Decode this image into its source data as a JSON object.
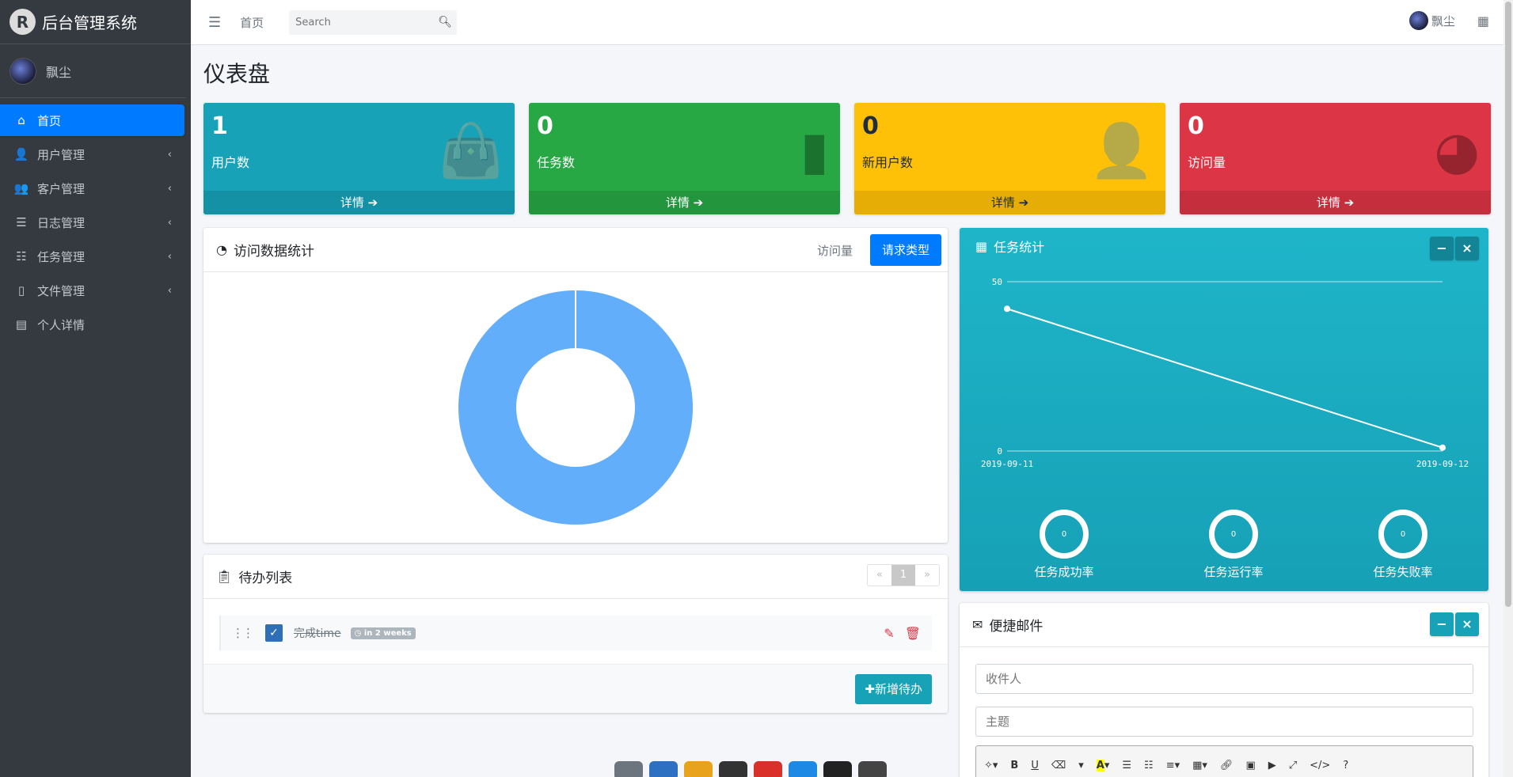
{
  "brand": {
    "title": "后台管理系统",
    "logo_letter": "R"
  },
  "user": {
    "name": "飘尘"
  },
  "sidebar": {
    "items": [
      {
        "label": "首页",
        "icon": "home-icon",
        "glyph": "⌂",
        "active": true,
        "has_caret": false
      },
      {
        "label": "用户管理",
        "icon": "user-icon",
        "glyph": "👤",
        "active": false,
        "has_caret": true
      },
      {
        "label": "客户管理",
        "icon": "users-icon",
        "glyph": "👥",
        "active": false,
        "has_caret": true
      },
      {
        "label": "日志管理",
        "icon": "database-icon",
        "glyph": "☰",
        "active": false,
        "has_caret": true
      },
      {
        "label": "任务管理",
        "icon": "tasks-icon",
        "glyph": "☷",
        "active": false,
        "has_caret": true
      },
      {
        "label": "文件管理",
        "icon": "file-icon",
        "glyph": "▯",
        "active": false,
        "has_caret": true
      },
      {
        "label": "个人详情",
        "icon": "id-card-icon",
        "glyph": "▤",
        "active": false,
        "has_caret": false
      }
    ]
  },
  "topbar": {
    "home": "首页",
    "search_placeholder": "Search",
    "user": "飘尘"
  },
  "page": {
    "title": "仪表盘"
  },
  "stat_boxes": [
    {
      "value": "1",
      "label": "用户数",
      "footer": "详情 ➔",
      "icon": "shopping-bag-icon",
      "glyph": "👜",
      "color": "#17a2b8"
    },
    {
      "value": "0",
      "label": "任务数",
      "footer": "详情 ➔",
      "icon": "bar-chart-icon",
      "glyph": "▮",
      "color": "#28a745"
    },
    {
      "value": "0",
      "label": "新用户数",
      "footer": "详情 ➔",
      "icon": "user-plus-icon",
      "glyph": "👤",
      "color": "#ffc107"
    },
    {
      "value": "0",
      "label": "访问量",
      "footer": "详情 ➔",
      "icon": "pie-chart-icon",
      "glyph": "◕",
      "color": "#dc3545"
    }
  ],
  "visit_card": {
    "title": "访问数据统计",
    "tab_link": "访问量",
    "tab_active": "请求类型"
  },
  "todo_card": {
    "title": "待办列表",
    "pager": [
      "«",
      "1",
      "»"
    ],
    "items": [
      {
        "text": "完成time",
        "badge": "in 2 weeks",
        "done": true
      }
    ],
    "add_button": "✚新增待办"
  },
  "task_card": {
    "title": "任务统计",
    "knobs": [
      {
        "label": "任务成功率",
        "value": "0"
      },
      {
        "label": "任务运行率",
        "value": "0"
      },
      {
        "label": "任务失败率",
        "value": "0"
      }
    ]
  },
  "mail_card": {
    "title": "便捷邮件",
    "to_placeholder": "收件人",
    "subject_placeholder": "主题"
  },
  "colors": {
    "sidebar": "#343a40",
    "primary": "#007bff",
    "info": "#17a2b8",
    "success": "#28a745",
    "warning": "#ffc107",
    "danger": "#dc3545",
    "donut": "#63aefb"
  },
  "chart_data": [
    {
      "type": "pie",
      "title": "",
      "values": [
        1
      ],
      "note_inner": "donut"
    },
    {
      "type": "line",
      "title": "",
      "x": [
        "2019-09-11",
        "2019-09-12"
      ],
      "series": [
        {
          "values": [
            42,
            1
          ]
        }
      ],
      "ylim": [
        0,
        50
      ],
      "yticks": [
        "0",
        "50"
      ],
      "grid": true
    }
  ]
}
